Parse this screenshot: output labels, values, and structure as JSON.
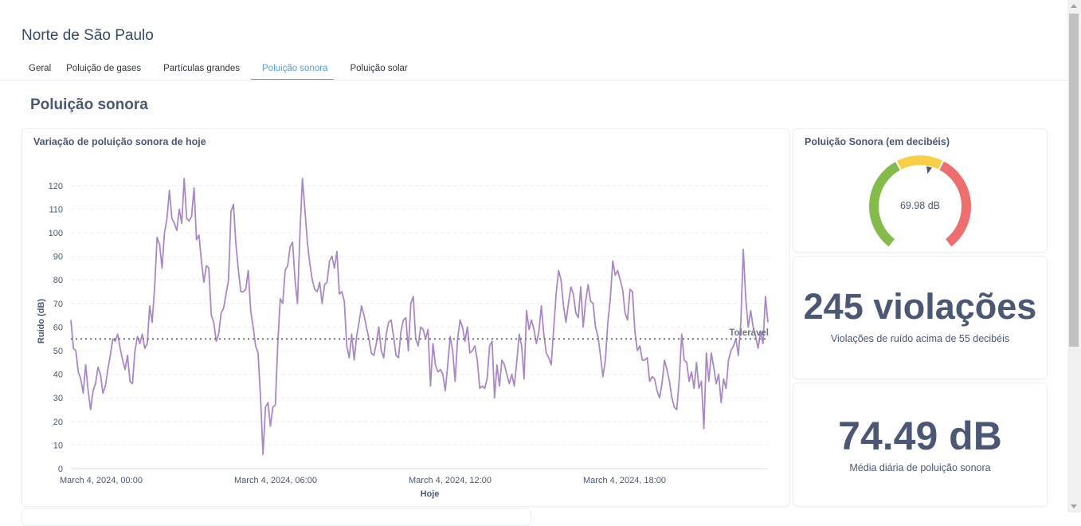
{
  "dashboard": {
    "title": "Norte de São Paulo"
  },
  "tabs": [
    {
      "label": "Geral",
      "active": false
    },
    {
      "label": "Poluição de gases",
      "active": false
    },
    {
      "label": "Partículas grandes",
      "active": false
    },
    {
      "label": "Poluição sonora",
      "active": true
    },
    {
      "label": "Poluição solar",
      "active": false
    }
  ],
  "section": {
    "title": "Poluição sonora"
  },
  "line_card": {
    "title": "Variação de poluição sonora de hoje"
  },
  "gauge_card": {
    "title": "Poluição Sonora (em decibéis)",
    "value_label": "69.98 dB",
    "value": 69.98,
    "colors": {
      "low": "#84bb4c",
      "mid": "#f9cf48",
      "high": "#ed6e6e"
    }
  },
  "violations_card": {
    "value": "245 violações",
    "caption": "Violações de ruído acima de 55 decibéis"
  },
  "average_card": {
    "value": "74.49 dB",
    "caption": "Média diária de poluição sonora"
  },
  "colors": {
    "line": "#a989c5",
    "accent": "#509ee3",
    "text": "#4c5773"
  },
  "chart_data": {
    "type": "line",
    "title": "Variação de poluição sonora de hoje",
    "xlabel": "Hoje",
    "ylabel": "Ruído (dB)",
    "ylim": [
      0,
      125
    ],
    "yticks": [
      0,
      10,
      20,
      30,
      40,
      50,
      60,
      70,
      80,
      90,
      100,
      110,
      120
    ],
    "x_tick_labels": [
      "March 4, 2024, 00:00",
      "March 4, 2024, 06:00",
      "March 4, 2024, 12:00",
      "March 4, 2024, 18:00"
    ],
    "grid": true,
    "goal": {
      "label": "Tolerável",
      "value": 55
    },
    "series": [
      {
        "values": [
          63,
          51,
          50,
          41,
          38,
          32,
          44,
          33,
          25,
          33,
          36,
          43,
          40,
          32,
          35,
          42,
          48,
          55,
          54,
          57,
          51,
          46,
          42,
          48,
          37,
          36,
          50,
          56,
          53,
          57,
          51,
          53,
          69,
          62,
          77,
          98,
          95,
          85,
          100,
          106,
          118,
          106,
          104,
          101,
          110,
          104,
          123,
          106,
          105,
          107,
          119,
          97,
          99,
          88,
          79,
          86,
          85,
          65,
          62,
          54,
          57,
          66,
          68,
          74,
          80,
          109,
          112,
          95,
          84,
          75,
          75,
          76,
          84,
          67,
          60,
          52,
          49,
          30,
          6,
          26,
          28,
          18,
          26,
          27,
          53,
          72,
          70,
          84,
          86,
          94,
          96,
          80,
          70,
          100,
          123,
          110,
          96,
          87,
          80,
          76,
          75,
          79,
          70,
          78,
          79,
          88,
          90,
          85,
          92,
          74,
          75,
          71,
          52,
          47,
          57,
          46,
          56,
          62,
          69,
          65,
          60,
          55,
          49,
          48,
          53,
          60,
          50,
          47,
          57,
          62,
          63,
          56,
          48,
          47,
          58,
          63,
          64,
          50,
          70,
          73,
          55,
          52,
          60,
          59,
          55,
          59,
          35,
          53,
          44,
          41,
          42,
          40,
          33,
          44,
          56,
          50,
          37,
          55,
          63,
          60,
          54,
          60,
          49,
          50,
          52,
          46,
          34,
          35,
          34,
          38,
          52,
          54,
          30,
          44,
          35,
          46,
          44,
          40,
          36,
          40,
          35,
          45,
          57,
          52,
          38,
          67,
          59,
          63,
          59,
          53,
          58,
          69,
          57,
          49,
          47,
          44,
          59,
          74,
          84,
          80,
          69,
          62,
          70,
          77,
          74,
          66,
          64,
          77,
          60,
          71,
          78,
          71,
          70,
          60,
          56,
          48,
          39,
          46,
          62,
          72,
          88,
          82,
          84,
          80,
          76,
          66,
          63,
          76,
          75,
          58,
          50,
          52,
          46,
          46,
          47,
          37,
          39,
          38,
          33,
          30,
          36,
          46,
          42,
          37,
          30,
          26,
          25,
          38,
          57,
          46,
          45,
          37,
          41,
          34,
          45,
          34,
          37,
          17,
          49,
          37,
          49,
          43,
          36,
          40,
          28,
          38,
          34,
          46,
          50,
          52,
          55,
          48,
          62,
          93,
          72,
          60,
          67,
          60,
          56,
          51,
          58,
          53,
          73,
          62
        ]
      }
    ]
  }
}
